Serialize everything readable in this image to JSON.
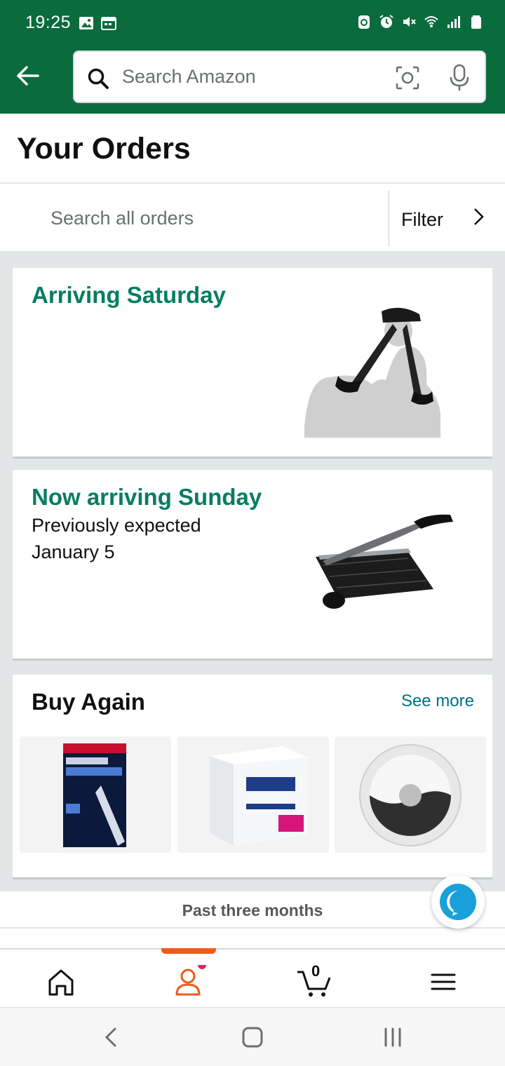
{
  "status_bar": {
    "time": "19:25"
  },
  "header": {
    "search_placeholder": "Search Amazon"
  },
  "page": {
    "title": "Your Orders"
  },
  "order_search": {
    "placeholder": "Search all orders",
    "filter_label": "Filter"
  },
  "orders": [
    {
      "status": "Arriving Saturday",
      "details": []
    },
    {
      "status": "Now arriving Sunday",
      "details": [
        "Previously expected",
        "January 5"
      ]
    }
  ],
  "buy_again": {
    "title": "Buy Again",
    "see_more": "See more"
  },
  "history": {
    "range_label": "Past three months"
  },
  "bottom_nav": {
    "cart_count": "0"
  },
  "colors": {
    "brand_green": "#0a6b3d",
    "status_teal": "#067d62",
    "link": "#007185",
    "nav_active": "#f05a1a"
  }
}
